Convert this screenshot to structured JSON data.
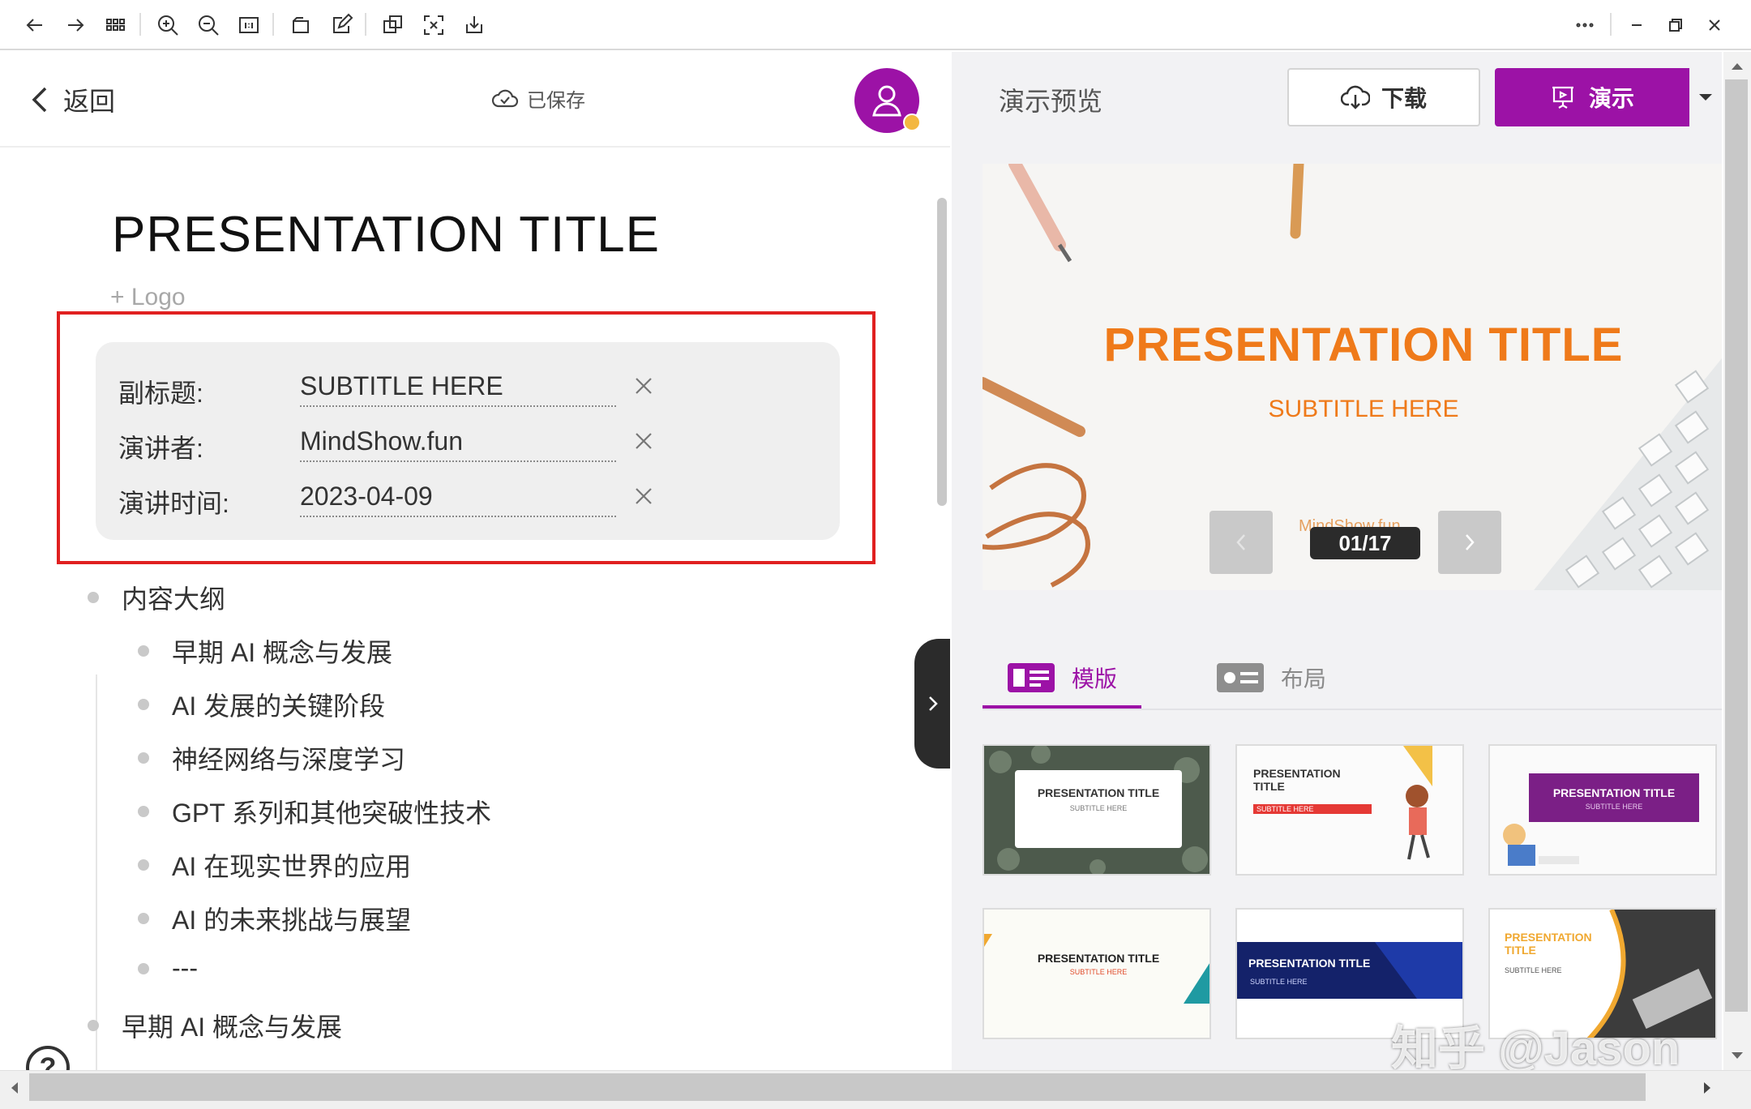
{
  "editor": {
    "back_label": "返回",
    "saved_label": "已保存",
    "title": "PRESENTATION TITLE",
    "add_logo": "+ Logo",
    "meta": [
      {
        "label": "副标题:",
        "value": "SUBTITLE HERE"
      },
      {
        "label": "演讲者:",
        "value": "MindShow.fun"
      },
      {
        "label": "演讲时间:",
        "value": "2023-04-09"
      }
    ],
    "outline": [
      "内容大纲",
      "早期 AI 概念与发展",
      "AI 发展的关键阶段",
      "神经网络与深度学习",
      "GPT 系列和其他突破性技术",
      "AI 在现实世界的应用",
      "AI 的未来挑战与展望",
      "---",
      "早期 AI 概念与发展"
    ],
    "help_label": "?"
  },
  "preview": {
    "title": "演示预览",
    "download_label": "下载",
    "present_label": "演示",
    "slide": {
      "title": "PRESENTATION TITLE",
      "subtitle": "SUBTITLE HERE",
      "maker": "MindShow.fun",
      "counter": "01/17"
    },
    "tabs": [
      "模版",
      "布局"
    ],
    "templates": [
      {
        "title": "PRESENTATION TITLE",
        "subtitle": "SUBTITLE HERE"
      },
      {
        "title": "PRESENTATION TITLE",
        "subtitle": "SUBTITLE HERE"
      },
      {
        "title": "PRESENTATION TITLE",
        "subtitle": "SUBTITLE HERE"
      },
      {
        "title": "PRESENTATION TITLE",
        "subtitle": "SUBTITLE HERE"
      },
      {
        "title": "PRESENTATION TITLE",
        "subtitle": "SUBTITLE HERE"
      },
      {
        "title": "PRESENTATION TITLE",
        "subtitle": "SUBTITLE HERE"
      }
    ]
  },
  "watermark": "知乎 @Jason",
  "colors": {
    "accent": "#9c12a6",
    "slide_orange": "#ef7a1a",
    "highlight_frame": "#e02020"
  },
  "icons": {
    "toolbar": [
      "back-arrow-icon",
      "forward-arrow-icon",
      "grid-icon",
      "zoom-in-icon",
      "zoom-out-icon",
      "fit-page-icon",
      "rotate-icon",
      "edit-icon",
      "copy-icon",
      "screenshot-icon",
      "download-icon",
      "more-icon",
      "minimize-icon",
      "restore-icon",
      "close-icon"
    ]
  }
}
